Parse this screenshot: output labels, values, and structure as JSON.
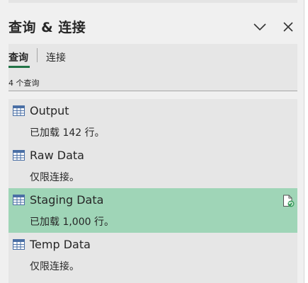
{
  "pane": {
    "title": "查询 & 连接",
    "collapse_icon": "chevron-down-icon",
    "close_icon": "close-icon"
  },
  "tabs": [
    {
      "label": "查询",
      "active": true
    },
    {
      "label": "连接",
      "active": false
    }
  ],
  "query_count": "4 个查询",
  "queries": [
    {
      "name": "Output",
      "status": "已加载 142 行。",
      "icon": "table-icon",
      "selected": false
    },
    {
      "name": "Raw Data",
      "status": "仅限连接。",
      "icon": "table-icon",
      "selected": false
    },
    {
      "name": "Staging Data",
      "status": "已加载 1,000 行。",
      "icon": "table-icon",
      "selected": true,
      "action_icon": "refresh-document-icon"
    },
    {
      "name": "Temp Data",
      "status": "仅限连接。",
      "icon": "table-icon",
      "selected": false
    }
  ],
  "colors": {
    "accent": "#217346",
    "selection": "#9fd5b7",
    "table_icon": "#4a6fa5",
    "refresh": "#3a9d5d"
  }
}
